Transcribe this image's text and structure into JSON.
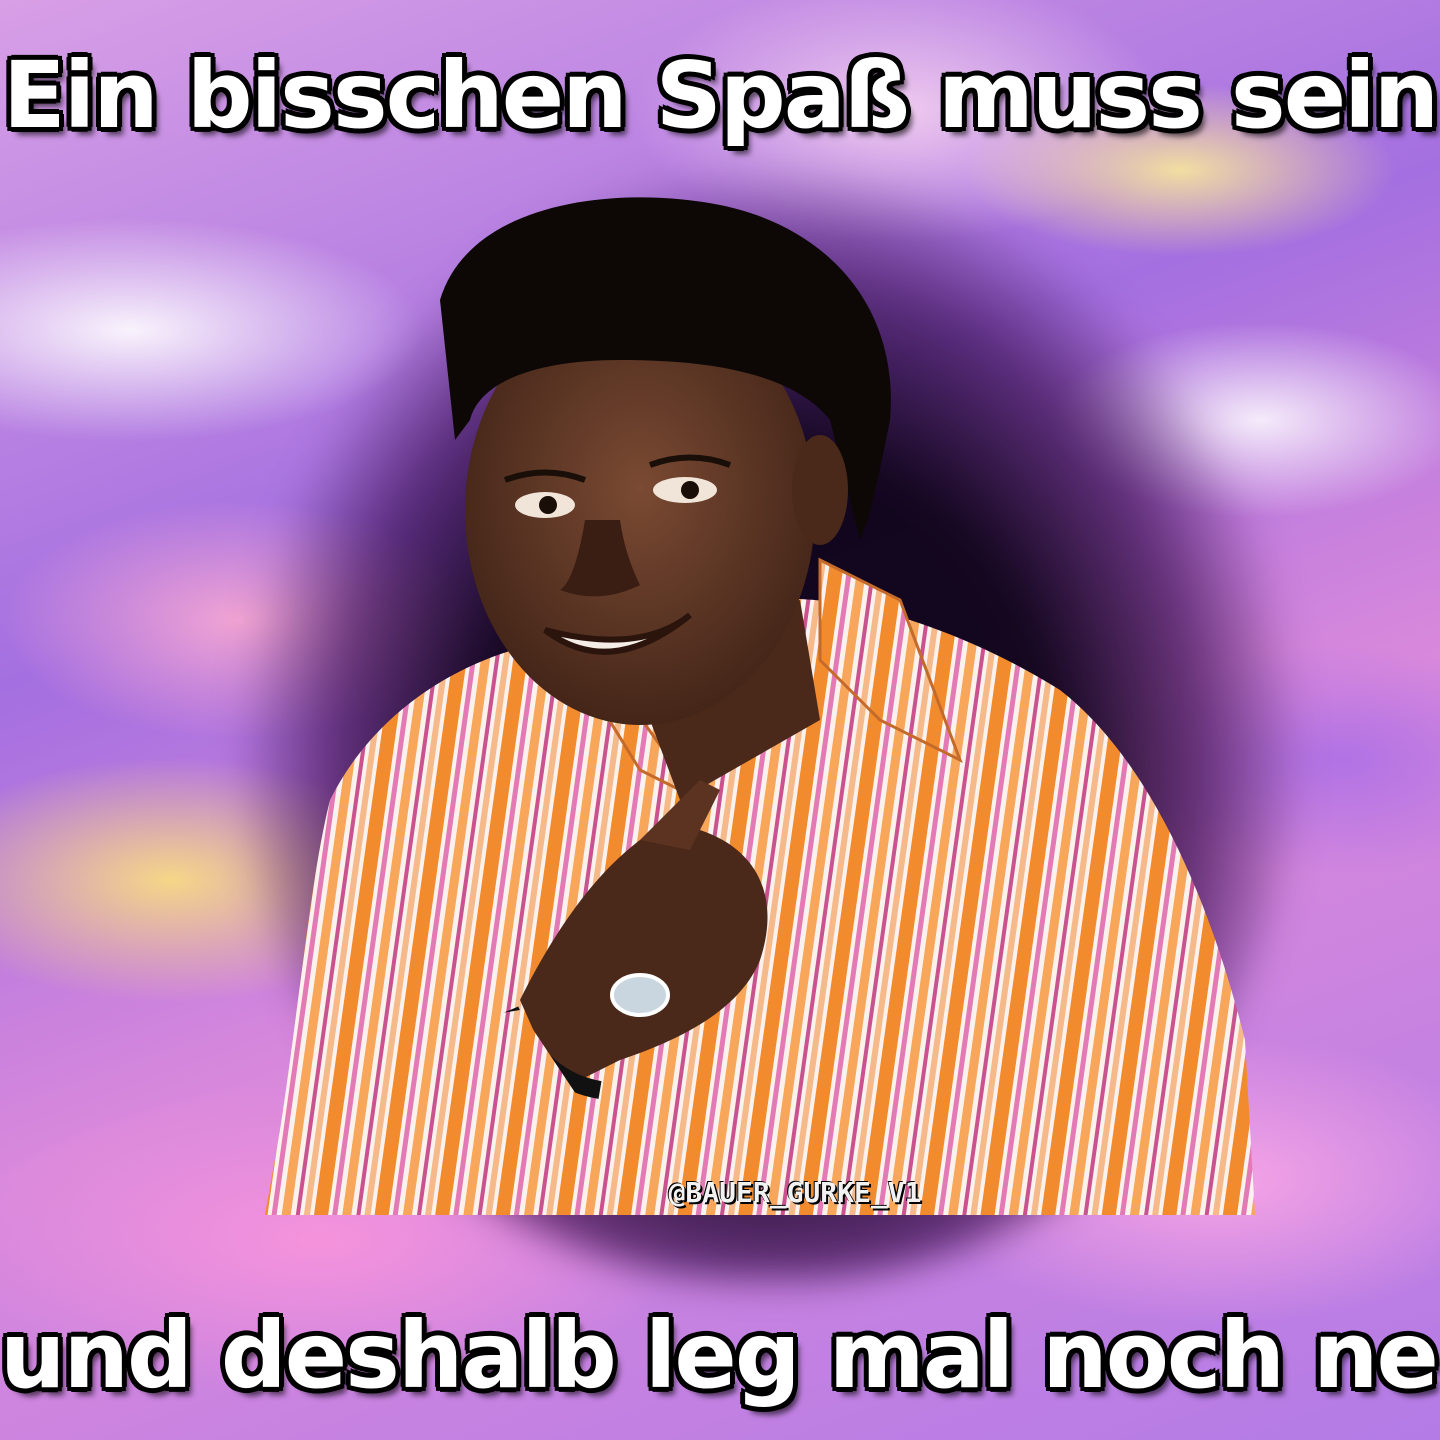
{
  "meme": {
    "caption_top": "Ein bisschen Spaß muss sein",
    "caption_bottom": "und deshalb leg mal noch ne Line",
    "watermark": "@BAUER_GURKE_V1"
  },
  "colors": {
    "sky_purple": "#a46fe0",
    "sky_pink": "#d989dc",
    "cloud_yellow": "#ffe678",
    "shirt_orange": "#f28a2e",
    "shirt_pink": "#e47ab5",
    "shirt_white": "#fbf2ee",
    "skin": "#5a3322",
    "hair": "#0d0806",
    "caption_text": "#ffffff",
    "caption_outline": "#000000"
  }
}
